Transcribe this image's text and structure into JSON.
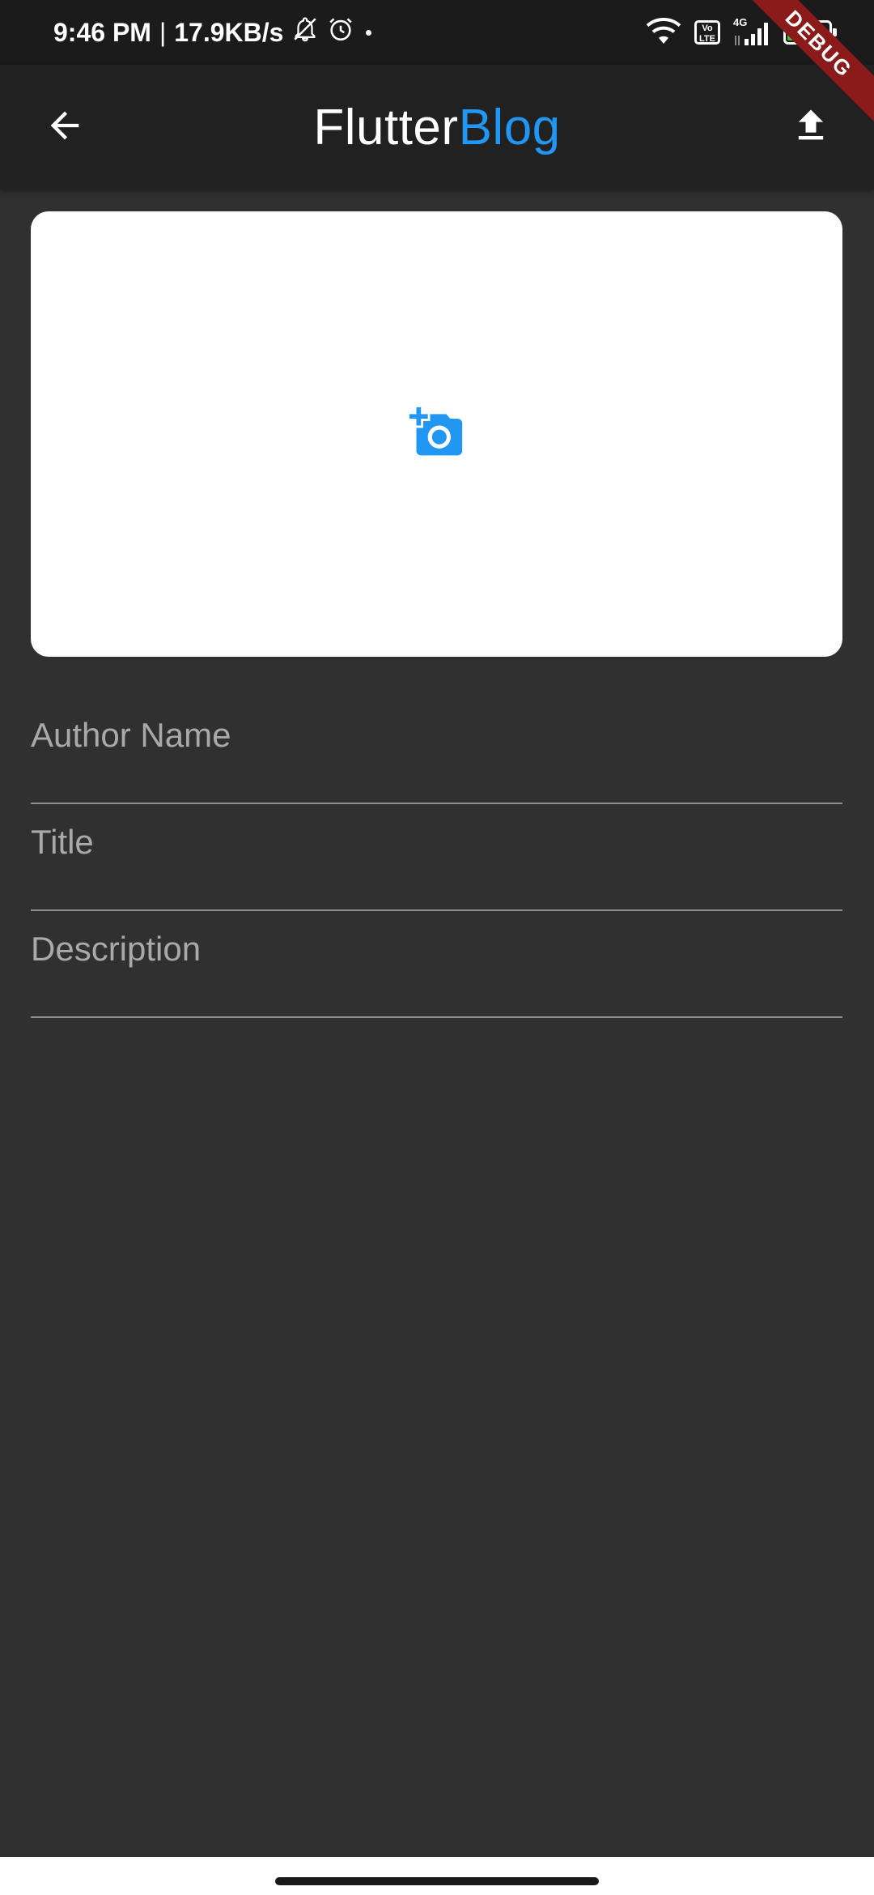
{
  "status_bar": {
    "time": "9:46 PM",
    "separator": "|",
    "speed": "17.9KB/s",
    "network_type": "4G",
    "volte_line1": "Vo",
    "volte_line2": "LTE",
    "battery_level": "72"
  },
  "debug_banner": "DEBUG",
  "app_bar": {
    "title_part1": "Flutter",
    "title_part2": "Blog",
    "title_part2_color": "#2196f3"
  },
  "form": {
    "author_placeholder": "Author Name",
    "title_placeholder": "Title",
    "description_placeholder": "Description"
  },
  "icons": {
    "back": "arrow-back-icon",
    "upload": "upload-icon",
    "add_photo": "add-a-photo-icon",
    "wifi": "wifi-icon",
    "signal": "signal-icon",
    "bell": "bell-off-icon",
    "alarm": "alarm-icon"
  },
  "colors": {
    "accent": "#2196f3",
    "app_bar": "#212121",
    "background": "#303030"
  }
}
